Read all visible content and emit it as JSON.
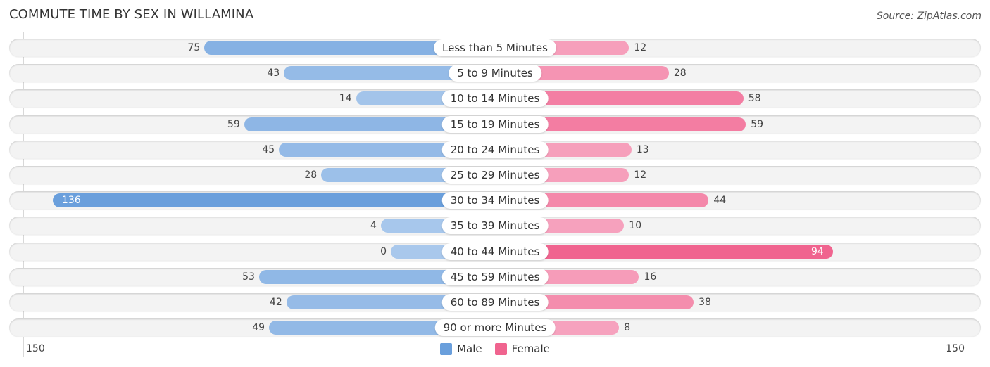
{
  "title": "COMMUTE TIME BY SEX IN WILLAMINA",
  "source": "Source: ZipAtlas.com",
  "colors": {
    "male": "#6a9fdc",
    "female": "#f0648f",
    "male_light": "#a9c8ec",
    "female_light": "#f7a8c2"
  },
  "chart_data": {
    "type": "bar",
    "orientation": "horizontal-diverging",
    "title": "COMMUTE TIME BY SEX IN WILLAMINA",
    "categories": [
      "Less than 5 Minutes",
      "5 to 9 Minutes",
      "10 to 14 Minutes",
      "15 to 19 Minutes",
      "20 to 24 Minutes",
      "25 to 29 Minutes",
      "30 to 34 Minutes",
      "35 to 39 Minutes",
      "40 to 44 Minutes",
      "45 to 59 Minutes",
      "60 to 89 Minutes",
      "90 or more Minutes"
    ],
    "series": [
      {
        "name": "Male",
        "values": [
          75,
          43,
          14,
          59,
          45,
          28,
          136,
          4,
          0,
          53,
          42,
          49
        ]
      },
      {
        "name": "Female",
        "values": [
          12,
          28,
          58,
          59,
          13,
          12,
          44,
          10,
          94,
          16,
          38,
          8
        ]
      }
    ],
    "xlim": [
      -150,
      150
    ],
    "tick_labels": {
      "left": "150",
      "right": "150"
    },
    "legend": [
      "Male",
      "Female"
    ],
    "legend_position": "bottom-center"
  }
}
